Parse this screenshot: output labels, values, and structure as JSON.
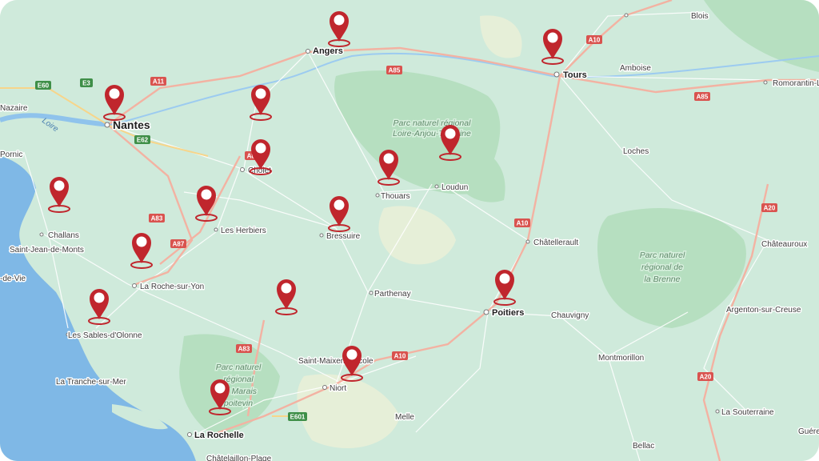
{
  "map": {
    "towns": [
      {
        "id": "blois",
        "label": "Blois"
      },
      {
        "id": "angers",
        "label": "Angers"
      },
      {
        "id": "tours",
        "label": "Tours"
      },
      {
        "id": "amboise",
        "label": "Amboise"
      },
      {
        "id": "romorantin",
        "label": "Romorantin-L"
      },
      {
        "id": "nazaire",
        "label": "Nazaire"
      },
      {
        "id": "nantes",
        "label": "Nantes"
      },
      {
        "id": "pornic",
        "label": "Pornic"
      },
      {
        "id": "cholet",
        "label": "Cholet"
      },
      {
        "id": "thouars",
        "label": "Thouars"
      },
      {
        "id": "loudun",
        "label": "Loudun"
      },
      {
        "id": "loches",
        "label": "Loches"
      },
      {
        "id": "challans",
        "label": "Challans"
      },
      {
        "id": "herbiers",
        "label": "Les Herbiers"
      },
      {
        "id": "bressuire",
        "label": "Bressuire"
      },
      {
        "id": "chatellerault",
        "label": "Châtellerault"
      },
      {
        "id": "chateauroux",
        "label": "Châteauroux"
      },
      {
        "id": "stjeandemonts",
        "label": "Saint-Jean-de-Monts"
      },
      {
        "id": "devie",
        "label": "-de-Vie"
      },
      {
        "id": "rochesuryon",
        "label": "La Roche-sur-Yon"
      },
      {
        "id": "parthenay",
        "label": "Parthenay"
      },
      {
        "id": "poitiers",
        "label": "Poitiers"
      },
      {
        "id": "chauvigny",
        "label": "Chauvigny"
      },
      {
        "id": "argenton",
        "label": "Argenton-sur-Creuse"
      },
      {
        "id": "sablesdolonne",
        "label": "Les Sables-d'Olonne"
      },
      {
        "id": "saintmaixent",
        "label": "Saint-Maixent-l'École"
      },
      {
        "id": "montmorillon",
        "label": "Montmorillon"
      },
      {
        "id": "tranche",
        "label": "La Tranche-sur-Mer"
      },
      {
        "id": "niort",
        "label": "Niort"
      },
      {
        "id": "melle",
        "label": "Melle"
      },
      {
        "id": "souterraine",
        "label": "La Souterraine"
      },
      {
        "id": "rochelle",
        "label": "La Rochelle"
      },
      {
        "id": "bellac",
        "label": "Bellac"
      },
      {
        "id": "gueret",
        "label": "Guére"
      },
      {
        "id": "chatelaillon",
        "label": "Châtelaillon-Plage"
      }
    ],
    "parks": [
      {
        "id": "loire-anjou",
        "lines": [
          "Parc naturel régional",
          "Loire-Anjou-Touraine"
        ]
      },
      {
        "id": "brenne",
        "lines": [
          "Parc naturel",
          "régional de",
          "la Brenne"
        ]
      },
      {
        "id": "marais",
        "lines": [
          "Parc naturel",
          "régional",
          "du Marais",
          "poitevin"
        ]
      }
    ],
    "water": {
      "river_label": "Loire"
    },
    "roads": [
      {
        "id": "a11",
        "label": "A11",
        "type": "motorway"
      },
      {
        "id": "a85a",
        "label": "A85",
        "type": "motorway"
      },
      {
        "id": "a85b",
        "label": "A85",
        "type": "motorway"
      },
      {
        "id": "a10a",
        "label": "A10",
        "type": "motorway"
      },
      {
        "id": "a10b",
        "label": "A10",
        "type": "motorway"
      },
      {
        "id": "a10c",
        "label": "A10",
        "type": "motorway"
      },
      {
        "id": "a83a",
        "label": "A83",
        "type": "motorway"
      },
      {
        "id": "a83b",
        "label": "A83",
        "type": "motorway"
      },
      {
        "id": "a87",
        "label": "A87",
        "type": "motorway"
      },
      {
        "id": "a20a",
        "label": "A20",
        "type": "motorway"
      },
      {
        "id": "a20b",
        "label": "A20",
        "type": "motorway"
      },
      {
        "id": "a87b",
        "label": "A87",
        "type": "motorway"
      },
      {
        "id": "e60",
        "label": "E60",
        "type": "euro"
      },
      {
        "id": "e3",
        "label": "E3",
        "type": "euro"
      },
      {
        "id": "e62",
        "label": "E62",
        "type": "euro"
      },
      {
        "id": "e601",
        "label": "E601",
        "type": "euro"
      }
    ],
    "markers": [
      {
        "id": "marker-angers-north",
        "icon": "map-pin-icon",
        "color": "#c0262d"
      },
      {
        "id": "marker-tours",
        "icon": "map-pin-icon",
        "color": "#c0262d"
      },
      {
        "id": "marker-nantes",
        "icon": "map-pin-icon",
        "color": "#c0262d"
      },
      {
        "id": "marker-nord-cholet",
        "icon": "map-pin-icon",
        "color": "#c0262d"
      },
      {
        "id": "marker-cholet",
        "icon": "map-pin-icon",
        "color": "#c0262d"
      },
      {
        "id": "marker-thouars",
        "icon": "map-pin-icon",
        "color": "#c0262d"
      },
      {
        "id": "marker-loudun",
        "icon": "map-pin-icon",
        "color": "#c0262d"
      },
      {
        "id": "marker-challans",
        "icon": "map-pin-icon",
        "color": "#c0262d"
      },
      {
        "id": "marker-herbiers",
        "icon": "map-pin-icon",
        "color": "#c0262d"
      },
      {
        "id": "marker-bressuire",
        "icon": "map-pin-icon",
        "color": "#c0262d"
      },
      {
        "id": "marker-roche-sur-yon",
        "icon": "map-pin-icon",
        "color": "#c0262d"
      },
      {
        "id": "marker-poitiers",
        "icon": "map-pin-icon",
        "color": "#c0262d"
      },
      {
        "id": "marker-sables",
        "icon": "map-pin-icon",
        "color": "#c0262d"
      },
      {
        "id": "marker-parthenay-west",
        "icon": "map-pin-icon",
        "color": "#c0262d"
      },
      {
        "id": "marker-saint-maixent",
        "icon": "map-pin-icon",
        "color": "#c0262d"
      },
      {
        "id": "marker-la-rochelle",
        "icon": "map-pin-icon",
        "color": "#c0262d"
      }
    ]
  }
}
